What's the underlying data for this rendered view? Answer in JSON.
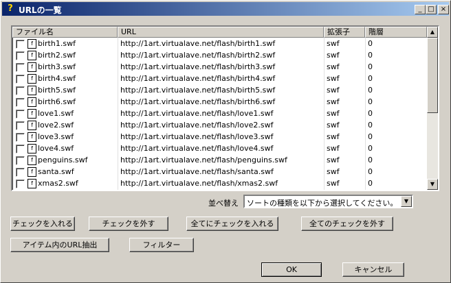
{
  "window": {
    "title": "URLの一覧",
    "icon": "question-icon",
    "controls": [
      "_",
      "□",
      "×"
    ]
  },
  "list": {
    "columns": [
      "ファイル名",
      "URL",
      "拡張子",
      "階層"
    ],
    "rows": [
      {
        "name": "birth1.swf",
        "url": "http://1art.virtualave.net/flash/birth1.swf",
        "ext": "swf",
        "level": "0"
      },
      {
        "name": "birth2.swf",
        "url": "http://1art.virtualave.net/flash/birth2.swf",
        "ext": "swf",
        "level": "0"
      },
      {
        "name": "birth3.swf",
        "url": "http://1art.virtualave.net/flash/birth3.swf",
        "ext": "swf",
        "level": "0"
      },
      {
        "name": "birth4.swf",
        "url": "http://1art.virtualave.net/flash/birth4.swf",
        "ext": "swf",
        "level": "0"
      },
      {
        "name": "birth5.swf",
        "url": "http://1art.virtualave.net/flash/birth5.swf",
        "ext": "swf",
        "level": "0"
      },
      {
        "name": "birth6.swf",
        "url": "http://1art.virtualave.net/flash/birth6.swf",
        "ext": "swf",
        "level": "0"
      },
      {
        "name": "love1.swf",
        "url": "http://1art.virtualave.net/flash/love1.swf",
        "ext": "swf",
        "level": "0"
      },
      {
        "name": "love2.swf",
        "url": "http://1art.virtualave.net/flash/love2.swf",
        "ext": "swf",
        "level": "0"
      },
      {
        "name": "love3.swf",
        "url": "http://1art.virtualave.net/flash/love3.swf",
        "ext": "swf",
        "level": "0"
      },
      {
        "name": "love4.swf",
        "url": "http://1art.virtualave.net/flash/love4.swf",
        "ext": "swf",
        "level": "0"
      },
      {
        "name": "penguins.swf",
        "url": "http://1art.virtualave.net/flash/penguins.swf",
        "ext": "swf",
        "level": "0"
      },
      {
        "name": "santa.swf",
        "url": "http://1art.virtualave.net/flash/santa.swf",
        "ext": "swf",
        "level": "0"
      },
      {
        "name": "xmas2.swf",
        "url": "http://1art.virtualave.net/flash/xmas2.swf",
        "ext": "swf",
        "level": "0"
      }
    ]
  },
  "sort": {
    "label": "並べ替え",
    "selected": "ソートの種類を以下から選択してください。"
  },
  "buttons": {
    "check_all_selected": "チェックを入れる",
    "uncheck_selected": "チェックを外す",
    "check_all": "全てにチェックを入れる",
    "uncheck_all": "全てのチェックを外す",
    "extract_urls": "アイテム内のURL抽出",
    "filter": "フィルター",
    "ok": "OK",
    "cancel": "キャンセル"
  },
  "colors": {
    "titlebar_start": "#0a246a",
    "titlebar_end": "#a6caf0",
    "face": "#d4d0c8"
  }
}
